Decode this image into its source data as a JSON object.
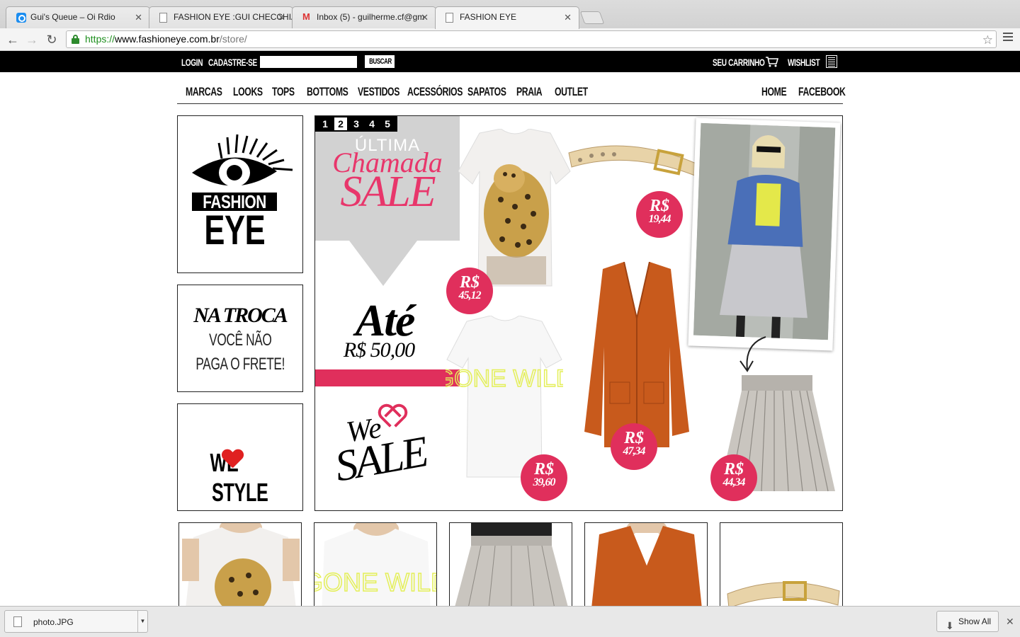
{
  "browser": {
    "tabs": [
      {
        "title": "Gui's Queue – Oi Rdio",
        "favicon": "rdio-icon"
      },
      {
        "title": "FASHION EYE :GUI CHECCHIA",
        "favicon": "page-icon"
      },
      {
        "title": "Inbox (5) - guilherme.cf@gm",
        "favicon": "gmail-icon"
      },
      {
        "title": "FASHION EYE",
        "favicon": "page-icon"
      }
    ],
    "url_scheme": "https://",
    "url_domain": "www.fashioneye.com.br",
    "url_path": "/store/"
  },
  "topbar": {
    "login": "LOGIN",
    "signup": "CADASTRE-SE",
    "search_value": "",
    "search_button": "BUSCAR",
    "cart": "SEU CARRINHO",
    "wishlist": "WISHLIST"
  },
  "nav": {
    "items": [
      "MARCAS",
      "LOOKS",
      "TOPS",
      "BOTTOMS",
      "VESTIDOS",
      "ACESSÓRIOS",
      "SAPATOS",
      "PRAIA",
      "OUTLET"
    ],
    "right": [
      "HOME",
      "FACEBOOK"
    ]
  },
  "logo": {
    "line1": "FASHION",
    "line2": "EYE"
  },
  "promo_troca": {
    "line1": "NA TROCA",
    "line2": "VOCÊ NÃO",
    "line3": "PAGA O FRETE!"
  },
  "promo_style": {
    "we": "WE",
    "style": "STYLE"
  },
  "banner": {
    "pages": [
      "1",
      "2",
      "3",
      "4",
      "5"
    ],
    "selected_page": "2",
    "ultima": "ÚLTIMA",
    "chamada": "Chamada",
    "sale": "SALE",
    "ate": "Até",
    "ate_price": "R$ 50,00",
    "we": "We",
    "we_sale": "SALE",
    "currency": "R$",
    "tshirt_text": "GONE WILD",
    "prices": {
      "leopard_tee": "45,12",
      "belt": "19,44",
      "gone_wild_tee": "39,60",
      "cardigan": "47,34",
      "skirt": "44,34"
    }
  },
  "colors": {
    "accent": "#e02f5c",
    "black": "#000000",
    "grey": "#d2d2d2"
  },
  "downloads": {
    "file": "photo.JPG",
    "show_all": "Show All"
  }
}
